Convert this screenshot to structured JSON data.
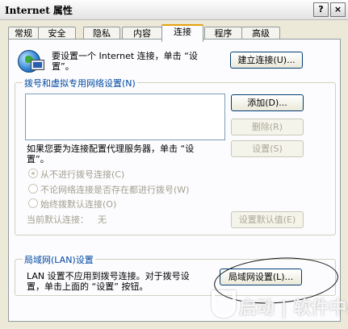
{
  "window": {
    "title": "Internet 属性",
    "help": "?",
    "close": "×"
  },
  "tabs": [
    "常规",
    "安全",
    "隐私",
    "内容",
    "连接",
    "程序",
    "高级"
  ],
  "setup": {
    "text_line1": "要设置一个 Internet 连接，单击 “设",
    "text_line2": "置”。",
    "button": "建立连接(U)..."
  },
  "dialup": {
    "legend": "拨号和虚拟专用网络设置(N)",
    "add_button": "添加(D)...",
    "remove_button": "删除(R)",
    "settings_button": "设置(S)",
    "proxy_text_line1": "如果您要为连接配置代理服务器，单击 “设",
    "proxy_text_line2": "置”。",
    "radio_never": "从不进行拨号连接(C)",
    "radio_when_no_network": "不论网络连接是否存在都进行拨号(W)",
    "radio_always": "始终拨默认连接(O)",
    "current_default_label": "当前默认连接：",
    "current_default_value": "无",
    "set_default_button": "设置默认值(E)"
  },
  "lan": {
    "legend": "局域网(LAN)设置",
    "text_line1": "LAN 设置不应用到拨号连接。对于拨号设",
    "text_line2": "置，单击上面的 “设置” 按钮。",
    "button": "局域网设置(L)..."
  },
  "watermark": {
    "text": "启动 | 软件中心"
  }
}
